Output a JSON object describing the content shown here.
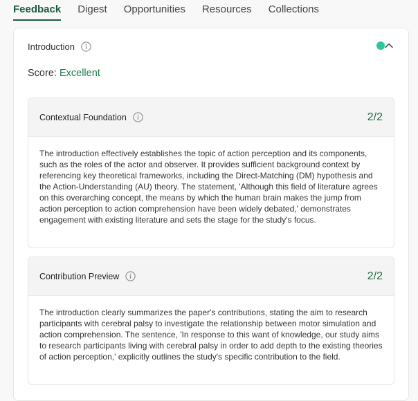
{
  "tabs": [
    {
      "label": "Feedback",
      "active": true
    },
    {
      "label": "Digest",
      "active": false
    },
    {
      "label": "Opportunities",
      "active": false
    },
    {
      "label": "Resources",
      "active": false
    },
    {
      "label": "Collections",
      "active": false
    }
  ],
  "section": {
    "title": "Introduction",
    "score_label": "Score:",
    "score_value": "Excellent",
    "status_color": "#2ec4a0"
  },
  "criteria": [
    {
      "title": "Contextual Foundation",
      "score": "2/2",
      "body": "The introduction effectively establishes the topic of action perception and its components, such as the roles of the actor and observer. It provides sufficient background context by referencing key theoretical frameworks, including the Direct-Matching (DM) hypothesis and the Action-Understanding (AU) theory. The statement, 'Although this field of literature agrees on this overarching concept, the means by which the human brain makes the jump from action perception to action comprehension have been widely debated,' demonstrates engagement with existing literature and sets the stage for the study's focus."
    },
    {
      "title": "Contribution Preview",
      "score": "2/2",
      "body": "The introduction clearly summarizes the paper's contributions, stating the aim to research participants with cerebral palsy to investigate the relationship between motor simulation and action comprehension. The sentence, 'In response to this want of knowledge, our study aims to research participants living with cerebral palsy in order to add depth to the existing theories of action perception,' explicitly outlines the study's specific contribution to the field."
    }
  ],
  "colors": {
    "accent": "#1c5b3e",
    "score_green": "#1f6b45"
  },
  "icons": {
    "info": "info-icon",
    "collapse": "chevron-up-icon"
  }
}
